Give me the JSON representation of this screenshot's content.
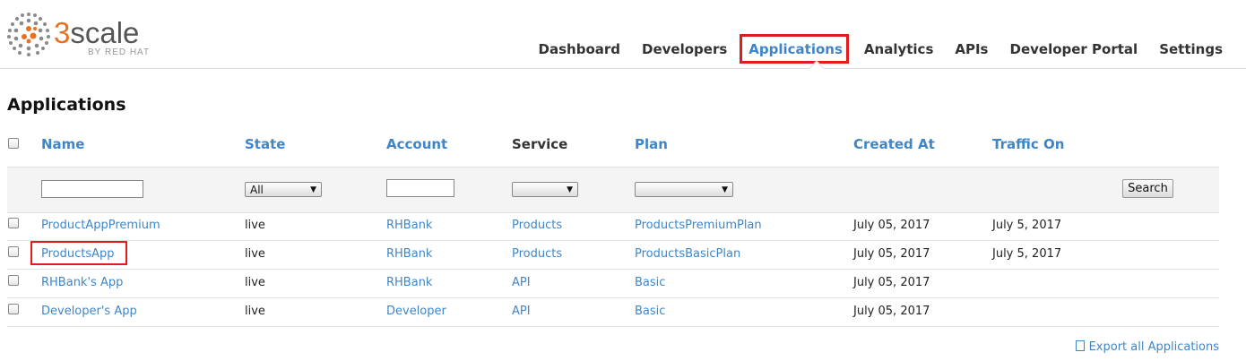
{
  "brand": {
    "logo_word_accent": "3",
    "logo_word_rest": "scale",
    "logo_sub": "BY RED HAT",
    "accent_color": "#e8701e"
  },
  "nav": {
    "items": [
      "Dashboard",
      "Developers",
      "Applications",
      "Analytics",
      "APIs",
      "Developer Portal",
      "Settings"
    ],
    "active": "Applications"
  },
  "page": {
    "title": "Applications"
  },
  "table": {
    "headers": {
      "name": "Name",
      "state": "State",
      "account": "Account",
      "service": "Service",
      "plan": "Plan",
      "created_at": "Created At",
      "traffic_on": "Traffic On"
    },
    "filters": {
      "state_selected": "All",
      "search_label": "Search"
    },
    "rows": [
      {
        "name": "ProductAppPremium",
        "state": "live",
        "account": "RHBank",
        "service": "Products",
        "plan": "ProductsPremiumPlan",
        "created_at": "July 05, 2017",
        "traffic_on": "July 5, 2017"
      },
      {
        "name": "ProductsApp",
        "state": "live",
        "account": "RHBank",
        "service": "Products",
        "plan": "ProductsBasicPlan",
        "created_at": "July 05, 2017",
        "traffic_on": "July 5, 2017"
      },
      {
        "name": "RHBank's App",
        "state": "live",
        "account": "RHBank",
        "service": "API",
        "plan": "Basic",
        "created_at": "July 05, 2017",
        "traffic_on": ""
      },
      {
        "name": "Developer's App",
        "state": "live",
        "account": "Developer",
        "service": "API",
        "plan": "Basic",
        "created_at": "July 05, 2017",
        "traffic_on": ""
      }
    ]
  },
  "export": {
    "label": "Export all Applications"
  },
  "annotations": {
    "highlight_color": "#e21c1c"
  }
}
